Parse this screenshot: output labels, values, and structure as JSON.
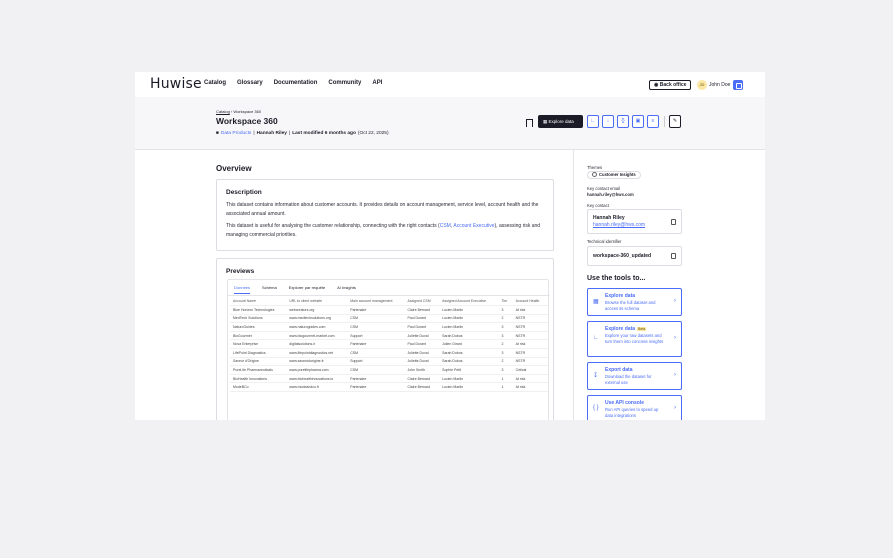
{
  "header": {
    "logo": "Huwise",
    "nav": [
      "Catalog",
      "Glossary",
      "Documentation",
      "Community",
      "API"
    ],
    "back_office": "Back office",
    "avatar_initials": "JD",
    "user": "John Doe"
  },
  "page": {
    "breadcrumb_root": "Catalog",
    "breadcrumb_current": "Workspace 360",
    "title": "Workspace 360",
    "category": "Data Products",
    "owner": "Hannah Riley",
    "modified": "Last modified 6 months ago",
    "modified_date": "(Oct 22, 2025)",
    "explore_label": "Explore data"
  },
  "overview": {
    "heading": "Overview",
    "desc_title": "Description",
    "p1": "This dataset contains information about customer accounts. It provides details on account management, service level, account health and the associated annual amount.",
    "p2_a": "This dataset is useful for analysing the customer relationship, connecting with the right contacts (",
    "p2_csm": "CSM",
    "p2_sep": ", ",
    "p2_ae": "Account Executive",
    "p2_b": "), assessing risk and managing commercial priorities."
  },
  "previews": {
    "heading": "Previews",
    "tabs": [
      "Données",
      "Schéma",
      "Explorer par requête",
      "AI Insights"
    ],
    "columns": [
      "Account Name",
      "URL to client website",
      "Main account management",
      "Assigned CSM",
      "Assigned Account Executive",
      "Tier",
      "Account Health"
    ],
    "rows": [
      [
        "Blue Horizon Technologies",
        "webcreators.org",
        "Partenaire",
        "Claire Bernard",
        "Lucien Martin",
        "3",
        "At risk"
      ],
      [
        "MedTech Solutions",
        "www.medtechsolutions.org",
        "CSM",
        "Paul Durant",
        "Lucien Martin",
        "2",
        "NSTR"
      ],
      [
        "NaturoGuides",
        "www.naturoguides.com",
        "CSM",
        "Paul Durant",
        "Lucien Martin",
        "3",
        "NSTR"
      ],
      [
        "BioGourmet",
        "www.biogourmet-market.com",
        "Support",
        "Juliette Duval",
        "Sarah Dubus",
        "3",
        "NSTR"
      ],
      [
        "Nova Enterprise",
        "digitalsolutions.ir",
        "Partenaire",
        "Paul Durant",
        "Julien Girard",
        "2",
        "At risk"
      ],
      [
        "LifePoint Diagnostics",
        "www.lifepointdiagnostics.net",
        "CSM",
        "Juliette Duval",
        "Sarah Dubus",
        "3",
        "NSTR"
      ],
      [
        "Saveur d'Origine",
        "www.saveurdorigine.fr",
        "Support",
        "Juliette Duval",
        "Sarah Dubus",
        "2",
        "NSTR"
      ],
      [
        "PureLife Pharmaceuticals",
        "www.purelifepharma.com",
        "CSM",
        "John Smith",
        "Sophie Petit",
        "3",
        "Critical"
      ],
      [
        "BioHealth Innovations",
        "www.biohealthinnovations.io",
        "Partenaire",
        "Claire Bernard",
        "Lucien Martin",
        "1",
        "At risk"
      ],
      [
        "ModeBCo",
        "www.modeandco.fr",
        "Partenaire",
        "Claire Bernard",
        "Lucien Martin",
        "1",
        "At risk"
      ]
    ]
  },
  "sidebar": {
    "themes_label": "Themes",
    "theme": "Customer Insights",
    "kce_label": "Key contact email",
    "kce": "hannah.riley@hws.com",
    "kc_label": "Key contact",
    "kc_name": "Hannah Riley",
    "kc_email": "hannah.riley@hws.com",
    "tech_label": "Technical identifier",
    "tech_id": "workspace-360_updated",
    "tools_heading": "Use the tools to...",
    "tools": [
      {
        "title": "Explore data",
        "desc": "Browse the full dataset and access its schema"
      },
      {
        "title": "Explore data",
        "badge": "Beta",
        "desc": "Explore your raw datasets and turn them into concrete insights"
      },
      {
        "title": "Export data",
        "desc": "Download the dataset for external use"
      },
      {
        "title": "Use API console",
        "desc": "Run API queries to speed up data integrations"
      }
    ]
  }
}
